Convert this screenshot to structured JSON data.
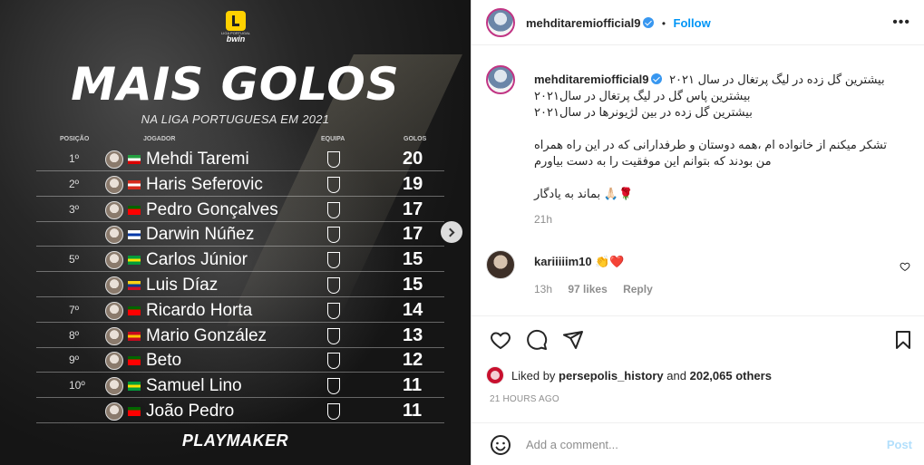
{
  "media": {
    "league_logo_text_top": "LIGA PORTUGAL",
    "league_logo_text": "bwin",
    "headline": "MAIS GOLOS",
    "subheadline": "NA LIGA PORTUGUESA EM 2021",
    "columns": {
      "position": "POSIÇÃO",
      "player": "JOGADOR",
      "team": "EQUIPA",
      "goals": "GOLOS"
    },
    "rows": [
      {
        "pos": "1º",
        "name": "Mehdi Taremi",
        "goals": "20"
      },
      {
        "pos": "2º",
        "name": "Haris Seferovic",
        "goals": "19"
      },
      {
        "pos": "3º",
        "name": "Pedro Gonçalves",
        "goals": "17"
      },
      {
        "pos": "",
        "name": "Darwin Núñez",
        "goals": "17"
      },
      {
        "pos": "5º",
        "name": "Carlos Júnior",
        "goals": "15"
      },
      {
        "pos": "",
        "name": "Luis Díaz",
        "goals": "15"
      },
      {
        "pos": "7º",
        "name": "Ricardo Horta",
        "goals": "14"
      },
      {
        "pos": "8º",
        "name": "Mario González",
        "goals": "13"
      },
      {
        "pos": "9º",
        "name": "Beto",
        "goals": "12"
      },
      {
        "pos": "10º",
        "name": "Samuel Lino",
        "goals": "11"
      },
      {
        "pos": "",
        "name": "João Pedro",
        "goals": "11"
      }
    ],
    "footer_brand": "PLAYMAKER"
  },
  "header": {
    "username": "mehditaremiofficial9",
    "separator": "•",
    "follow_label": "Follow",
    "more_icon": "more-options-icon"
  },
  "caption": {
    "username": "mehditaremiofficial9",
    "lines": [
      "بیشترین گل زده در لیگ پرتغال در سال ۲۰۲۱",
      "بیشترین پاس گل در لیگ پرتغال در سال۲۰۲۱",
      "بیشترین گل زده در بین لژیونرها در سال۲۰۲۱",
      "",
      "تشکر میکنم از خانواده ام ،همه دوستان و طرفدارانی که در این راه همراه",
      "من بودند که بتوانم این موفقیت را به دست بیاورم",
      "",
      "🌹🙏🏻 بماند به یادگار"
    ],
    "time": "21h"
  },
  "comment": {
    "username": "kariiiiim10",
    "text": "👏❤️",
    "time": "13h",
    "likes": "97 likes",
    "reply": "Reply"
  },
  "likes": {
    "prefix": "Liked by",
    "user": "persepolis_history",
    "middle": "and",
    "others": "202,065 others"
  },
  "timestamp": "21 HOURS AGO",
  "add_comment": {
    "placeholder": "Add a comment...",
    "post_label": "Post"
  }
}
